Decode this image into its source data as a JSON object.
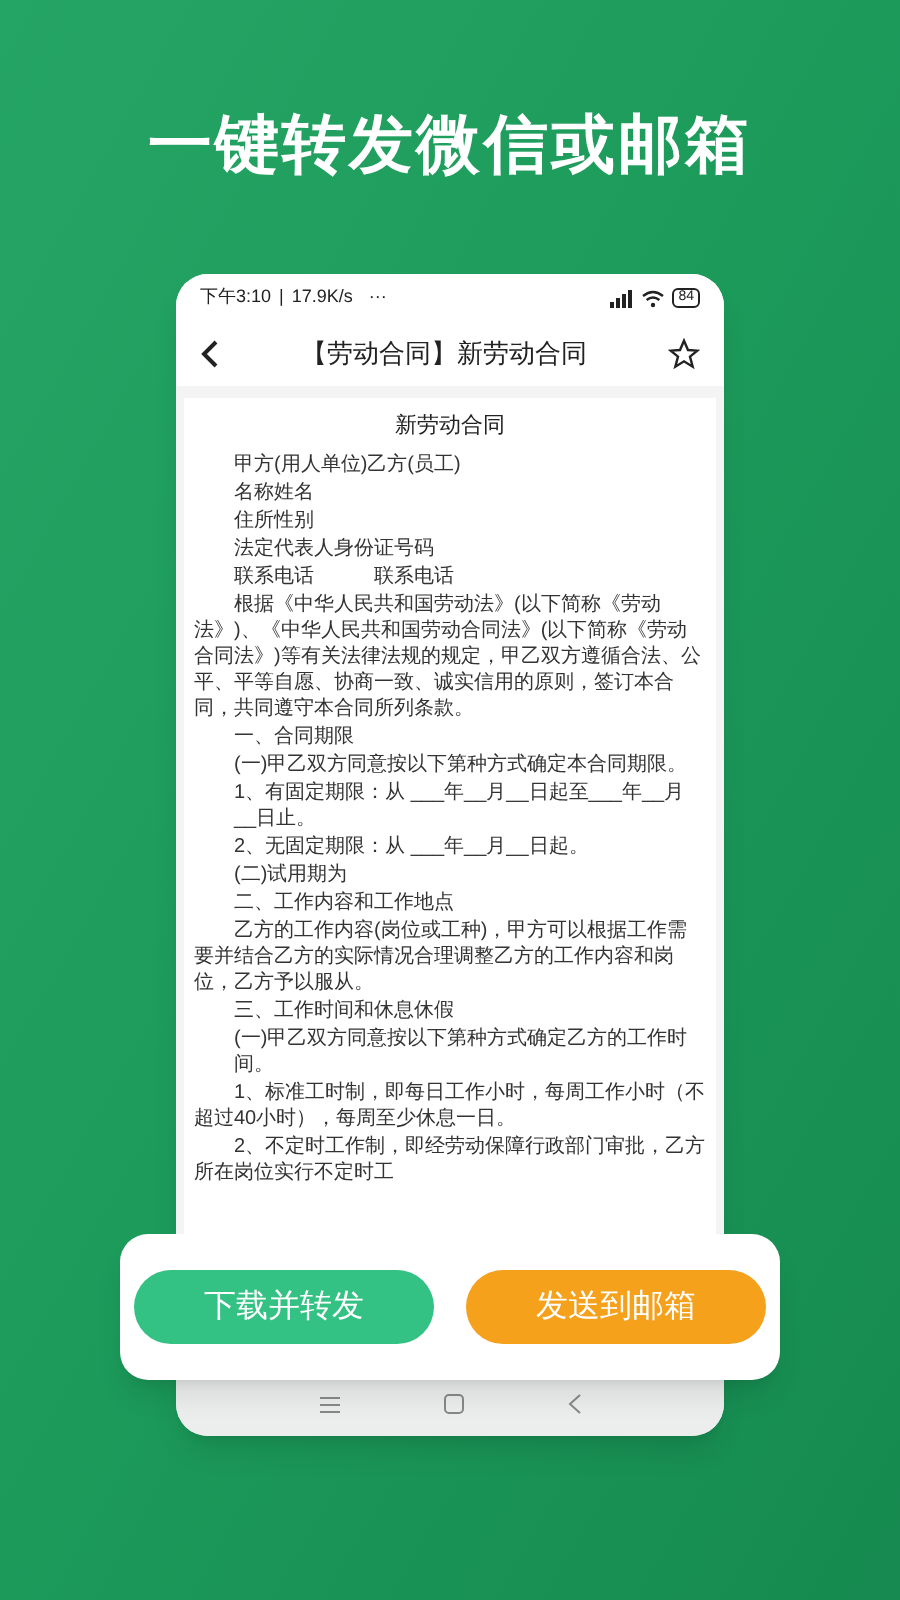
{
  "headline": "一键转发微信或邮箱",
  "status_bar": {
    "time": "下午3:10",
    "separator": "|",
    "speed": "17.9K/s",
    "more": "···",
    "battery": "84"
  },
  "header": {
    "title": "【劳动合同】新劳动合同",
    "starred": false
  },
  "document": [
    {
      "kind": "title",
      "text": "新劳动合同"
    },
    {
      "kind": "line",
      "text": "甲方(用人单位)乙方(员工)"
    },
    {
      "kind": "line",
      "text": "名称姓名"
    },
    {
      "kind": "line",
      "text": "住所性别"
    },
    {
      "kind": "line",
      "text": "法定代表人身份证号码"
    },
    {
      "kind": "line",
      "text": "联系电话　　　联系电话"
    },
    {
      "kind": "para",
      "text": "根据《中华人民共和国劳动法》(以下简称《劳动法》)、《中华人民共和国劳动合同法》(以下简称《劳动合同法》)等有关法律法规的规定，甲乙双方遵循合法、公平、平等自愿、协商一致、诚实信用的原则，签订本合同，共同遵守本合同所列条款。"
    },
    {
      "kind": "line",
      "text": "一、合同期限"
    },
    {
      "kind": "line",
      "text": "(一)甲乙双方同意按以下第种方式确定本合同期限。"
    },
    {
      "kind": "line",
      "text": "1、有固定期限：从 ___年__月__日起至___年__月__日止。"
    },
    {
      "kind": "line",
      "text": "2、无固定期限：从 ___年__月__日起。"
    },
    {
      "kind": "line",
      "text": "(二)试用期为"
    },
    {
      "kind": "line",
      "text": "二、工作内容和工作地点"
    },
    {
      "kind": "para",
      "text": "乙方的工作内容(岗位或工种)，甲方可以根据工作需要并结合乙方的实际情况合理调整乙方的工作内容和岗位，乙方予以服从。"
    },
    {
      "kind": "line",
      "text": "三、工作时间和休息休假"
    },
    {
      "kind": "line",
      "text": "(一)甲乙双方同意按以下第种方式确定乙方的工作时间。"
    },
    {
      "kind": "para",
      "text": "1、标准工时制，即每日工作小时，每周工作小时（不超过40小时），每周至少休息一日。"
    },
    {
      "kind": "para",
      "text": "2、不定时工作制，即经劳动保障行政部门审批，乙方所在岗位实行不定时工"
    }
  ],
  "actions": [
    {
      "kind": "primary",
      "label": "下载并转发"
    },
    {
      "kind": "accent",
      "label": "发送到邮箱"
    }
  ]
}
